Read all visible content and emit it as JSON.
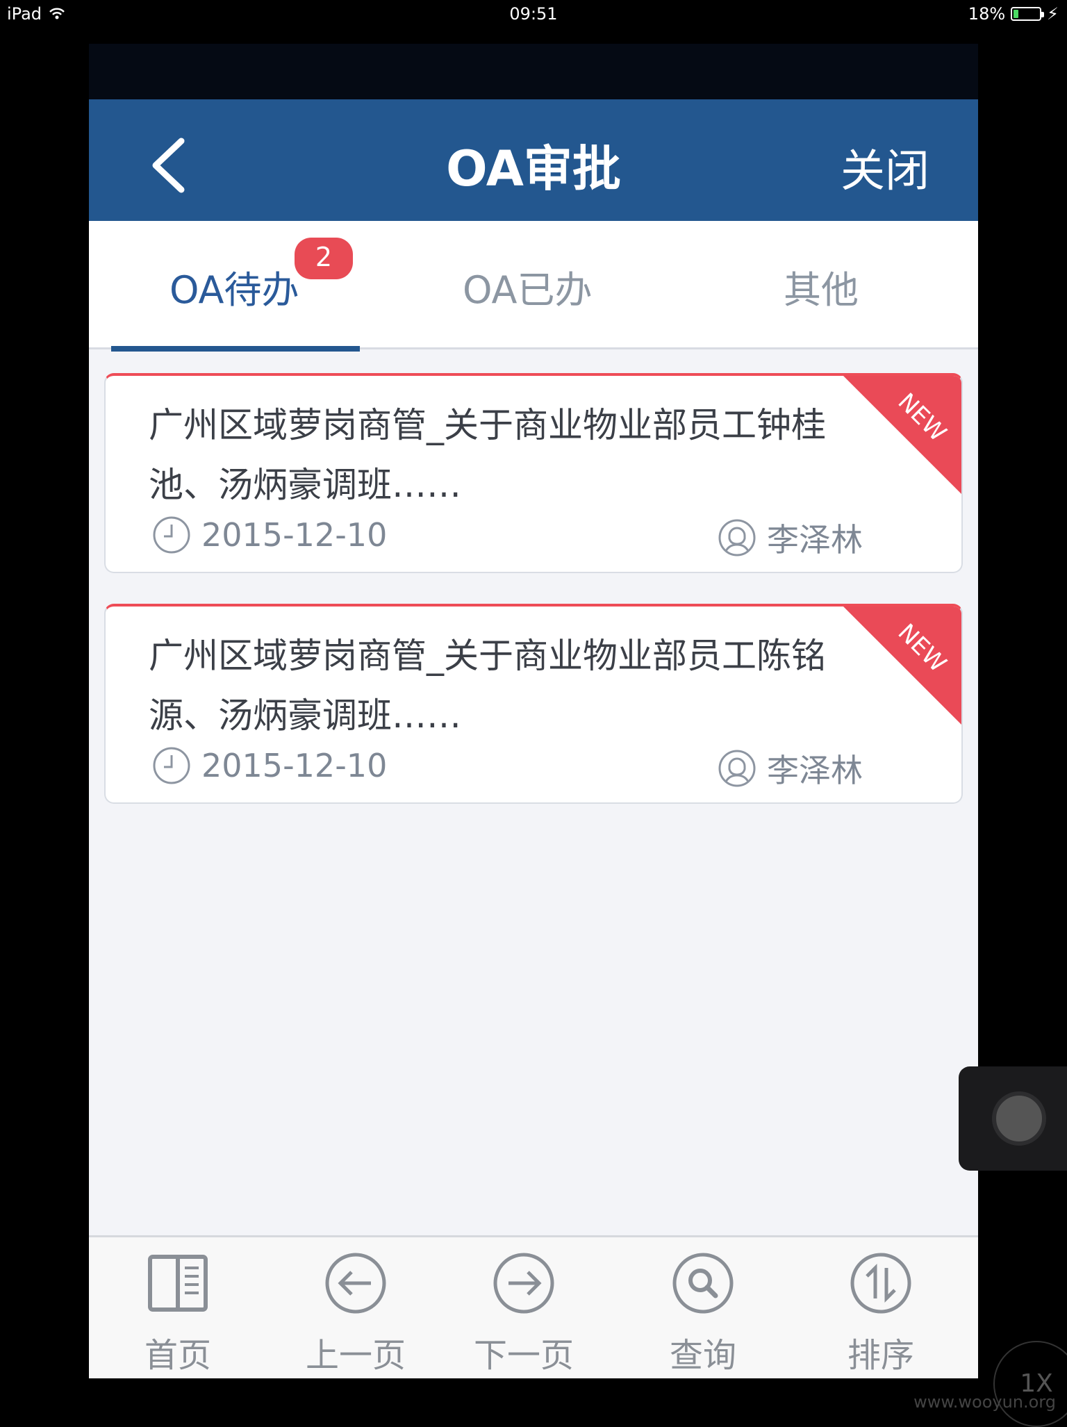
{
  "status": {
    "device": "iPad",
    "time": "09:51",
    "battery": "18%",
    "battery_level": 0.18
  },
  "header": {
    "title": "OA审批",
    "close_label": "关闭"
  },
  "tabs": [
    {
      "label": "OA待办",
      "badge": "2",
      "active": true
    },
    {
      "label": "OA已办",
      "active": false
    },
    {
      "label": "其他",
      "active": false
    }
  ],
  "items": [
    {
      "title": "广州区域萝岗商管_关于商业物业部员工钟桂池、汤炳豪调班……",
      "date": "2015-12-10",
      "person": "李泽林",
      "ribbon": "NEW"
    },
    {
      "title": "广州区域萝岗商管_关于商业物业部员工陈铭源、汤炳豪调班……",
      "date": "2015-12-10",
      "person": "李泽林",
      "ribbon": "NEW"
    }
  ],
  "bottom": {
    "home": "首页",
    "prev": "上一页",
    "next": "下一页",
    "search": "查询",
    "sort": "排序"
  },
  "overlay": {
    "watermark": "www.wooyun.org",
    "zoom": "1X"
  },
  "colors": {
    "header": "#23578f",
    "accent": "#ea4a57",
    "background": "#f3f4f8"
  }
}
